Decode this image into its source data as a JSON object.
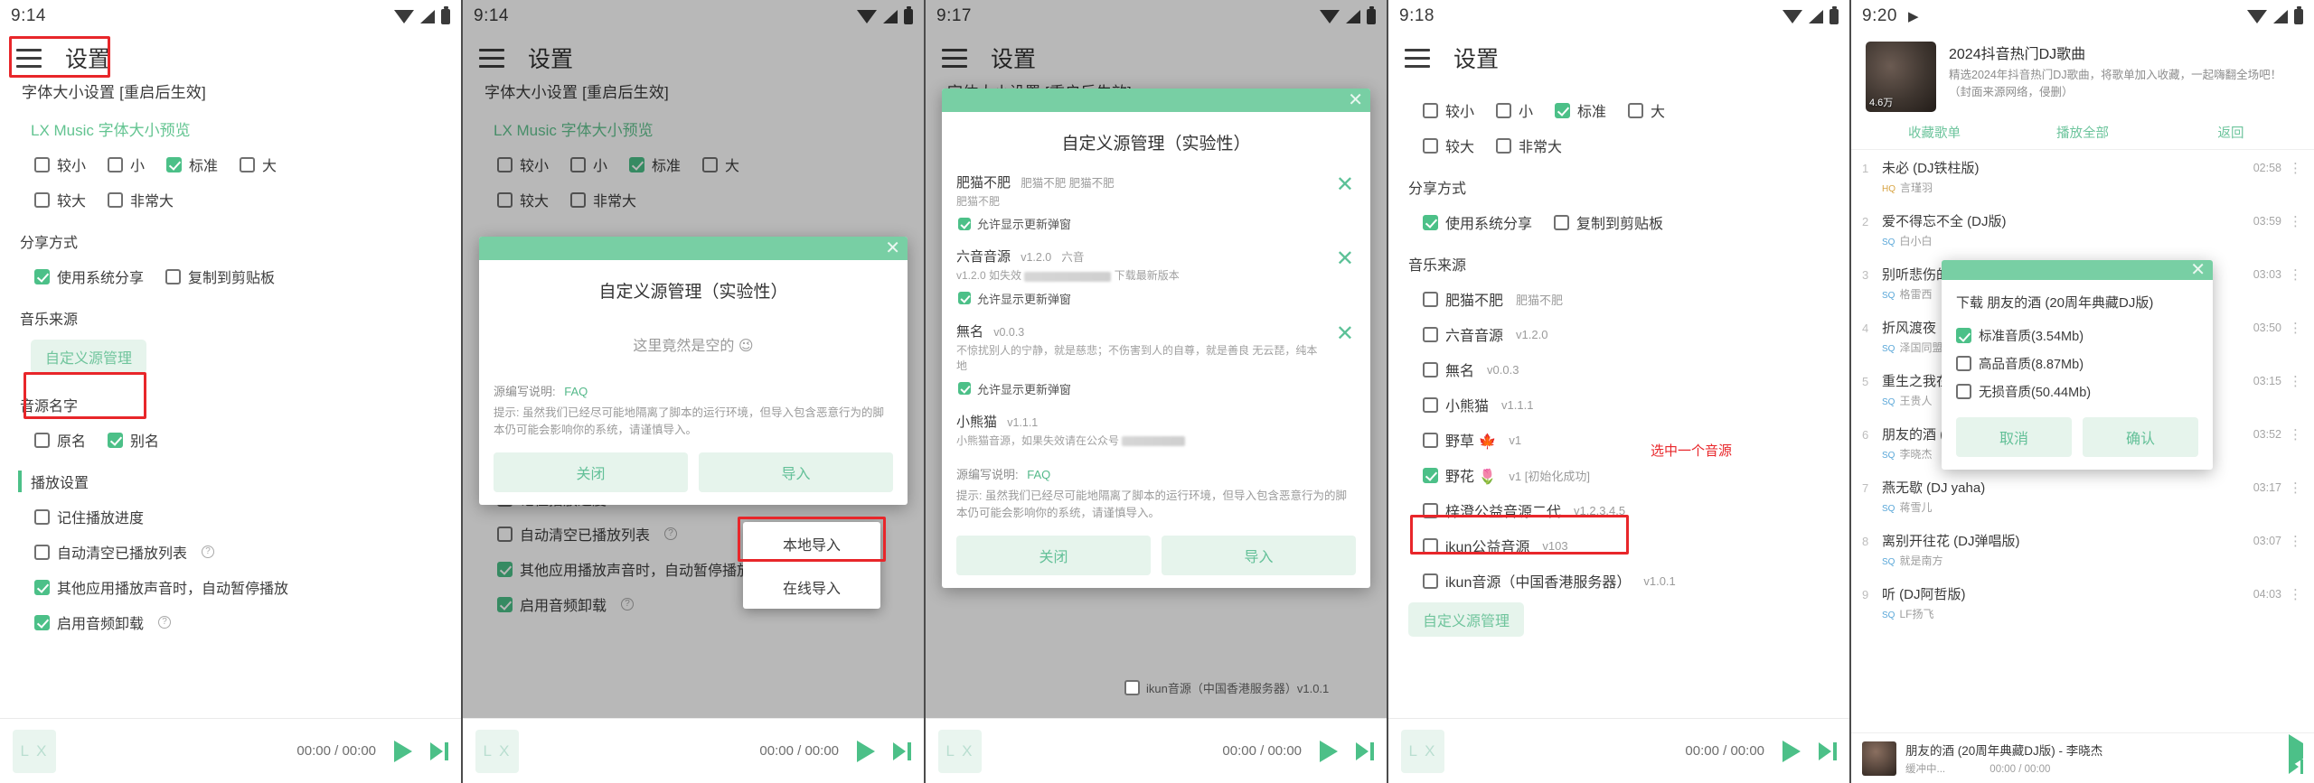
{
  "common": {
    "app_title": "设置",
    "clipped_header": "字体大小设置 [重启后生效]",
    "preview_label": "LX Music 字体大小预览",
    "font_sizes": [
      "较小",
      "小",
      "标准",
      "大",
      "较大",
      "非常大"
    ],
    "share_section": "分享方式",
    "share_options": [
      "使用系统分享",
      "复制到剪贴板"
    ],
    "music_source_section": "音乐来源",
    "custom_source_button": "自定义源管理",
    "source_name_section": "音源名字",
    "source_name_options": [
      "原名",
      "别名"
    ],
    "playback_section": "播放设置",
    "playback_options": [
      "记住播放进度",
      "自动清空已播放列表",
      "其他应用播放声音时，自动暂停播放",
      "启用音频卸载"
    ],
    "player_time": "00:00 / 00:00",
    "lx_thumb": "L X"
  },
  "panels": [
    {
      "id": "panel-1",
      "clock": "9:14",
      "note": "highlight-menu-and-custom-source"
    },
    {
      "id": "panel-2",
      "clock": "9:14",
      "dialog": {
        "title": "自定义源管理（实验性）",
        "empty_text": "这里竟然是空的 😉",
        "faq_prefix": "源编写说明:",
        "faq_link": "FAQ",
        "tip": "提示: 虽然我们已经尽可能地隔离了脚本的运行环境，但导入包含恶意行为的脚本仍可能会影响你的系统，请谨慎导入。",
        "close_button": "关闭",
        "import_button": "导入"
      },
      "popup": {
        "items": [
          "本地导入",
          "在线导入"
        ]
      }
    },
    {
      "id": "panel-3",
      "clock": "9:17",
      "dialog": {
        "title": "自定义源管理（实验性）",
        "faq_prefix": "源编写说明:",
        "faq_link": "FAQ",
        "tip": "提示: 虽然我们已经尽可能地隔离了脚本的运行环境，但导入包含恶意行为的脚本仍可能会影响你的系统，请谨慎导入。",
        "close_button": "关闭",
        "import_button": "导入",
        "sources": [
          {
            "name": "肥猫不肥",
            "version": "",
            "alias": "肥猫不肥  肥猫不肥",
            "desc": "肥猫不肥",
            "sub_label": "允许显示更新弹窗",
            "sub_checked": true
          },
          {
            "name": "六音音源",
            "version": "v1.2.0",
            "alias": "六音",
            "desc": "v1.2.0 如失效",
            "desc_tail": "下载最新版本",
            "sub_label": "允许显示更新弹窗",
            "sub_checked": true
          },
          {
            "name": "無名",
            "version": "v0.0.3",
            "alias": "",
            "desc": "不惊扰别人的宁静，就是慈悲；不伤害到人的自尊，就是善良 无云琵，纯本地",
            "sub_label": "允许显示更新弹窗",
            "sub_checked": true
          },
          {
            "name": "小熊猫",
            "version": "v1.1.1",
            "alias": "",
            "desc": "小熊猫音源，如果失效请在公众号",
            "sub_label": "",
            "sub_checked": false
          }
        ],
        "background_row": "ikun音源（中国香港服务器）v1.0.1"
      }
    },
    {
      "id": "panel-4",
      "clock": "9:18",
      "annotation": "选中一个音源",
      "sources": [
        {
          "name": "肥猫不肥",
          "version": "",
          "alias": "肥猫不肥",
          "checked": false
        },
        {
          "name": "六音音源",
          "version": "v1.2.0",
          "alias": "",
          "checked": false
        },
        {
          "name": "無名",
          "version": "v0.0.3",
          "alias": "",
          "checked": false
        },
        {
          "name": "小熊猫",
          "version": "v1.1.1",
          "alias": "",
          "checked": false
        },
        {
          "name": "野草 🍁",
          "version": "v1",
          "alias": "",
          "checked": false
        },
        {
          "name": "野花 🌷",
          "version": "v1 [初始化成功]",
          "alias": "",
          "checked": true
        },
        {
          "name": "梓澄公益音源二代",
          "version": "v1.2.3.4.5",
          "alias": "",
          "checked": false
        },
        {
          "name": "ikun公益音源",
          "version": "v103",
          "alias": "",
          "checked": false
        },
        {
          "name": "ikun音源（中国香港服务器）",
          "version": "v1.0.1",
          "alias": "",
          "checked": false
        }
      ],
      "custom_source_button": "自定义源管理"
    },
    {
      "id": "panel-5",
      "clock": "9:20",
      "playlist": {
        "title": "2024抖音热门DJ歌曲",
        "desc": "精选2024年抖音热门DJ歌曲，将歌单加入收藏，一起嗨翻全场吧！（封面来源网络，侵删）",
        "play_count": "4.6万",
        "tabs": [
          "收藏歌单",
          "播放全部",
          "返回"
        ],
        "songs": [
          {
            "idx": "1",
            "name": "未必 (DJ铁柱版)",
            "quality": "HQ",
            "artist": "言瑾羽",
            "dur": "02:58"
          },
          {
            "idx": "2",
            "name": "爱不得忘不全 (DJ版)",
            "quality": "SQ",
            "artist": "白小白",
            "dur": "03:59"
          },
          {
            "idx": "3",
            "name": "别听悲伤的歌",
            "quality": "SQ",
            "artist": "格雷西",
            "dur": "03:03"
          },
          {
            "idx": "4",
            "name": "折风渡夜",
            "quality": "SQ",
            "artist": "泽国同盟",
            "dur": "03:50"
          },
          {
            "idx": "5",
            "name": "重生之我在...",
            "quality": "SQ",
            "artist": "王贵人",
            "dur": "03:15"
          },
          {
            "idx": "6",
            "name": "朋友的酒 (20周年典藏DJ版)",
            "quality": "SQ",
            "artist": "李晓杰",
            "dur": "03:52"
          },
          {
            "idx": "7",
            "name": "燕无歇 (DJ yaha)",
            "quality": "SQ",
            "artist": "蒋雪儿",
            "dur": "03:17"
          },
          {
            "idx": "8",
            "name": "离别开往花 (DJ弹唱版)",
            "quality": "SQ",
            "artist": "就是南方",
            "dur": "03:07"
          },
          {
            "idx": "9",
            "name": "听 (DJ阿哲版)",
            "quality": "SQ",
            "artist": "LF扬飞",
            "dur": "04:03"
          }
        ],
        "now_playing": {
          "title": "朋友的酒 (20周年典藏DJ版) - 李晓杰",
          "status": "缓冲中...",
          "time": "00:00 / 00:00"
        }
      },
      "download_dialog": {
        "title": "下载 朋友的酒 (20周年典藏DJ版)",
        "options": [
          {
            "label": "标准音质(3.54Mb)",
            "checked": true
          },
          {
            "label": "高品音质(8.87Mb)",
            "checked": false
          },
          {
            "label": "无损音质(50.44Mb)",
            "checked": false
          }
        ],
        "cancel_button": "取消",
        "confirm_button": "确认"
      }
    }
  ],
  "colors": {
    "accent_green": "#4cc088",
    "dialog_header": "#78cfa4",
    "annotation_red": "#e8262a",
    "page_bg": "#fdf0e3"
  }
}
